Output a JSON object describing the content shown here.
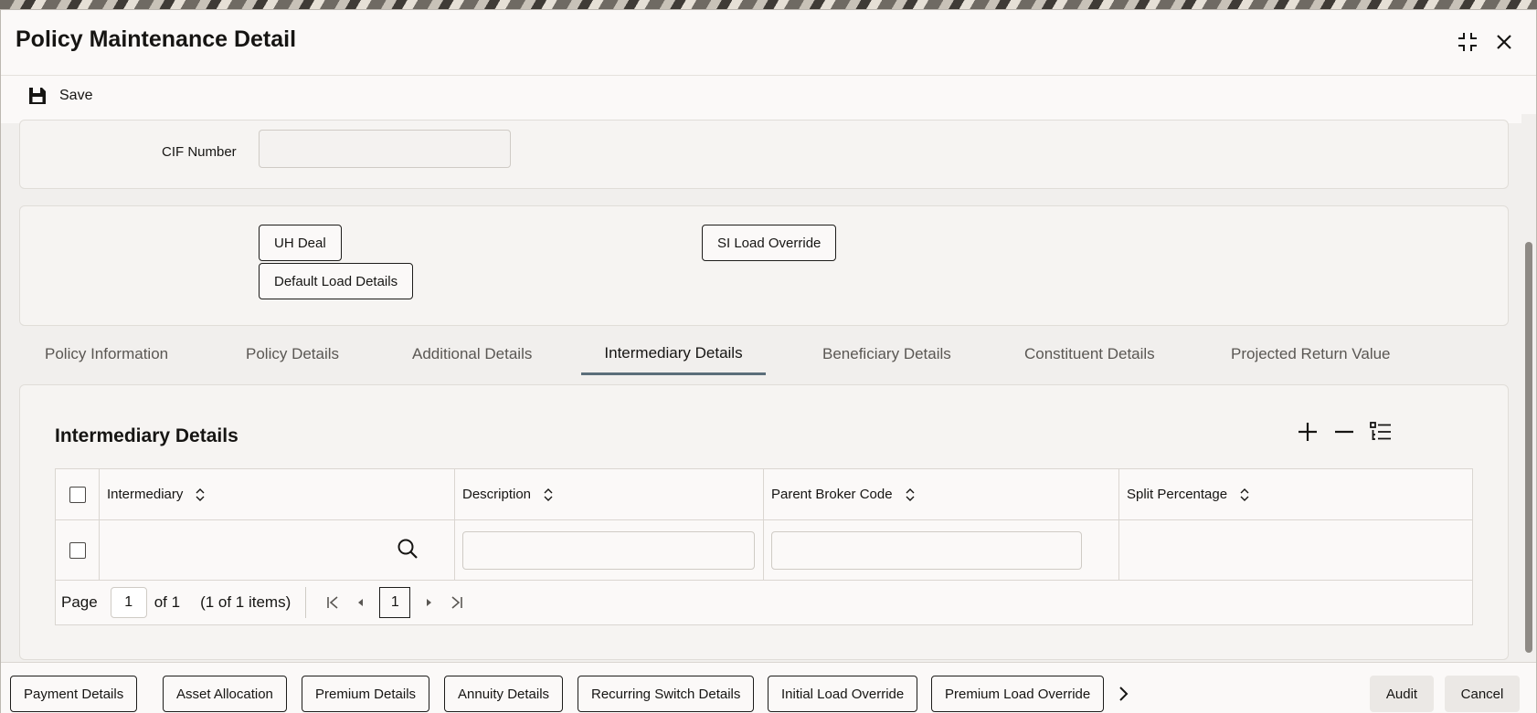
{
  "window": {
    "title": "Policy Maintenance Detail"
  },
  "toolbar": {
    "save_label": "Save"
  },
  "cif": {
    "label": "CIF Number",
    "value": ""
  },
  "buttons": {
    "uh_deal": "UH Deal",
    "default_load_details": "Default Load Details",
    "si_load_override": "SI Load Override"
  },
  "tabs": [
    {
      "label": "Policy Information",
      "active": false
    },
    {
      "label": "Policy Details",
      "active": false
    },
    {
      "label": "Additional Details",
      "active": false
    },
    {
      "label": "Intermediary Details",
      "active": true
    },
    {
      "label": "Beneficiary Details",
      "active": false
    },
    {
      "label": "Constituent Details",
      "active": false
    },
    {
      "label": "Projected Return Value",
      "active": false
    }
  ],
  "section": {
    "title": "Intermediary Details"
  },
  "grid": {
    "columns": [
      "Intermediary",
      "Description",
      "Parent Broker Code",
      "Split Percentage"
    ],
    "rows": [
      {
        "intermediary": "",
        "description": "",
        "parent_broker_code": "",
        "split_percentage": ""
      }
    ]
  },
  "pager": {
    "page_label": "Page",
    "page_value": "1",
    "of_label": "of 1",
    "items_label": "(1 of 1 items)",
    "current": "1"
  },
  "footer": {
    "buttons": [
      "Payment Details",
      "Asset Allocation",
      "Premium Details",
      "Annuity Details",
      "Recurring Switch Details",
      "Initial Load Override",
      "Premium Load Override"
    ],
    "audit": "Audit",
    "cancel": "Cancel"
  },
  "icons": {
    "save": "save-icon",
    "maximize": "collapse-icon",
    "close": "close-icon",
    "add": "plus-icon",
    "remove": "minus-icon",
    "view": "list-view-icon",
    "search": "search-icon",
    "more": "chevron-right-icon"
  }
}
